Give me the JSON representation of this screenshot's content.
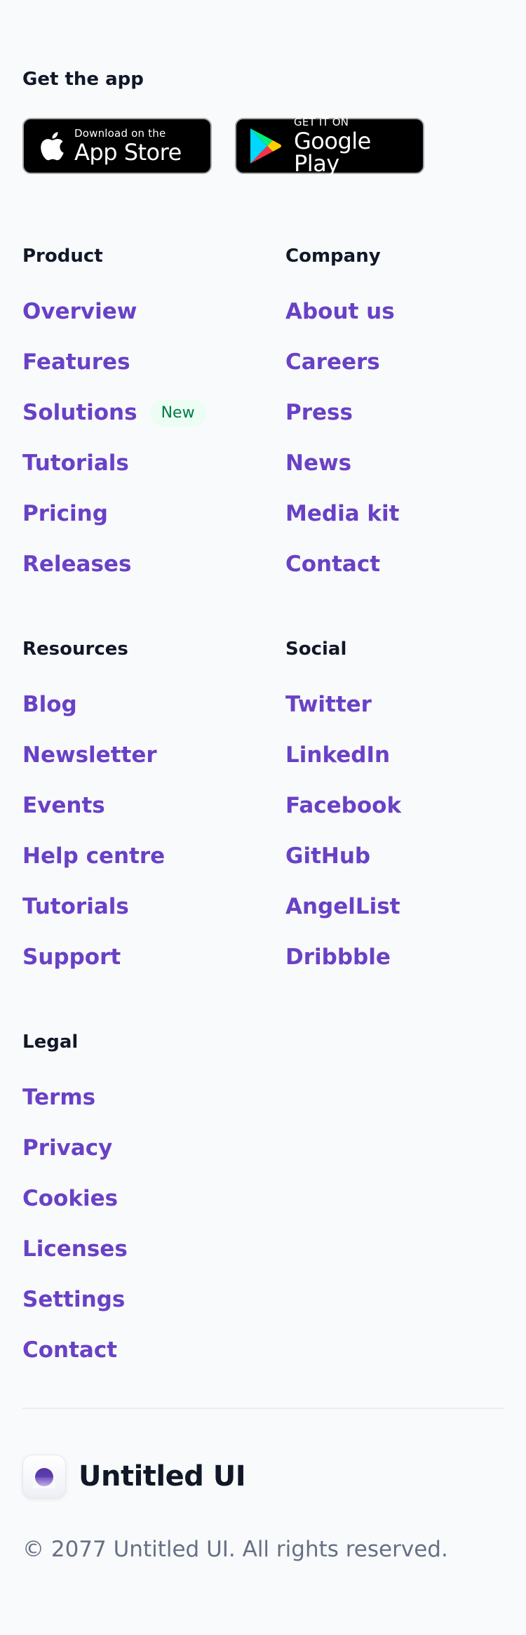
{
  "app_section": {
    "heading": "Get the app",
    "app_store": {
      "small_text": "Download on the",
      "big_text": "App Store"
    },
    "google_play": {
      "small_text": "GET IT ON",
      "big_text": "Google Play"
    }
  },
  "columns": [
    {
      "heading": "Product",
      "links": [
        {
          "label": "Overview"
        },
        {
          "label": "Features"
        },
        {
          "label": "Solutions",
          "badge": "New"
        },
        {
          "label": "Tutorials"
        },
        {
          "label": "Pricing"
        },
        {
          "label": "Releases"
        }
      ]
    },
    {
      "heading": "Company",
      "links": [
        {
          "label": "About us"
        },
        {
          "label": "Careers"
        },
        {
          "label": "Press"
        },
        {
          "label": "News"
        },
        {
          "label": "Media kit"
        },
        {
          "label": "Contact"
        }
      ]
    },
    {
      "heading": "Resources",
      "links": [
        {
          "label": "Blog"
        },
        {
          "label": "Newsletter"
        },
        {
          "label": "Events"
        },
        {
          "label": "Help centre"
        },
        {
          "label": "Tutorials"
        },
        {
          "label": "Support"
        }
      ]
    },
    {
      "heading": "Social",
      "links": [
        {
          "label": "Twitter"
        },
        {
          "label": "LinkedIn"
        },
        {
          "label": "Facebook"
        },
        {
          "label": "GitHub"
        },
        {
          "label": "AngelList"
        },
        {
          "label": "Dribbble"
        }
      ]
    },
    {
      "heading": "Legal",
      "links": [
        {
          "label": "Terms"
        },
        {
          "label": "Privacy"
        },
        {
          "label": "Cookies"
        },
        {
          "label": "Licenses"
        },
        {
          "label": "Settings"
        },
        {
          "label": "Contact"
        }
      ]
    }
  ],
  "brand": {
    "name": "Untitled UI"
  },
  "copyright": "© 2077 Untitled UI. All rights reserved.",
  "colors": {
    "link": "#6941c6",
    "heading": "#101828",
    "muted": "#667085",
    "new_badge_bg": "#ecfdf3",
    "new_badge_text": "#027a48",
    "background": "#f9fafb"
  },
  "icons": {
    "app_store": "apple-logo-icon",
    "google_play": "google-play-logo-icon",
    "brand": "untitled-ui-logo-icon"
  }
}
